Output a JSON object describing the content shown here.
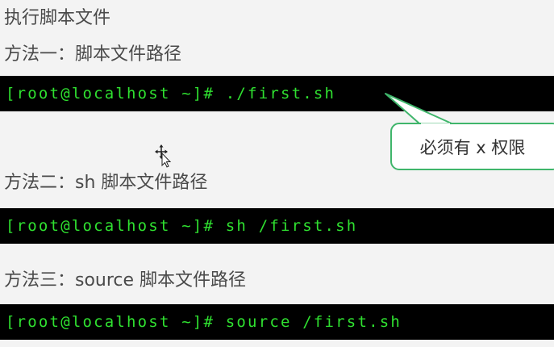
{
  "heading": "执行脚本文件",
  "methods": [
    {
      "label": "方法一：脚本文件路径",
      "command": "[root@localhost ~]# ./first.sh"
    },
    {
      "label": "方法二：sh  脚本文件路径",
      "command": "[root@localhost ~]# sh /first.sh"
    },
    {
      "label": "方法三：source  脚本文件路径",
      "command": "[root@localhost ~]# source /first.sh"
    }
  ],
  "callout": {
    "text": "必须有 x 权限",
    "border_color": "#3fb56b"
  },
  "colors": {
    "terminal_bg": "#000000",
    "terminal_text": "#2fe030",
    "page_bg": "#f3f3f3"
  },
  "icons": {
    "cursor": "move-cursor-icon"
  }
}
